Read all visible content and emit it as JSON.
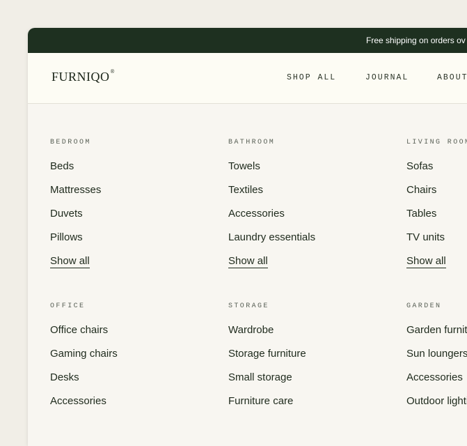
{
  "promo_banner": {
    "text": "Free shipping on orders ov"
  },
  "header": {
    "logo": "FURNIQO",
    "logo_mark": "®",
    "nav": [
      "SHOP ALL",
      "JOURNAL",
      "ABOUT"
    ]
  },
  "menu": {
    "groups": [
      {
        "title": "BEDROOM",
        "items": [
          "Beds",
          "Mattresses",
          "Duvets",
          "Pillows"
        ],
        "show_all": "Show all"
      },
      {
        "title": "BATHROOM",
        "items": [
          "Towels",
          "Textiles",
          "Accessories",
          "Laundry essentials"
        ],
        "show_all": "Show all"
      },
      {
        "title": "LIVING ROOM",
        "items": [
          "Sofas",
          "Chairs",
          "Tables",
          "TV units"
        ],
        "show_all": "Show all"
      },
      {
        "title": "OFFICE",
        "items": [
          "Office chairs",
          "Gaming chairs",
          "Desks",
          "Accessories"
        ]
      },
      {
        "title": "STORAGE",
        "items": [
          "Wardrobe",
          "Storage furniture",
          "Small storage",
          "Furniture care"
        ]
      },
      {
        "title": "GARDEN",
        "items": [
          "Garden furniture",
          "Sun loungers",
          "Accessories",
          "Outdoor lighting"
        ]
      }
    ]
  },
  "colors": {
    "banner_bg": "#1e3020",
    "header_bg": "#fdfcf4",
    "page_bg": "#f8f6f1",
    "backdrop": "#f1eee7",
    "text": "#1e2a1c"
  }
}
